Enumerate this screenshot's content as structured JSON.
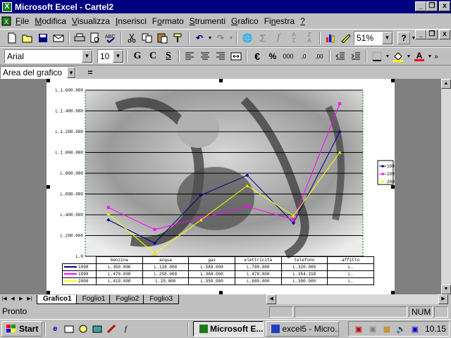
{
  "window": {
    "title": "Microsoft Excel - Cartel2",
    "app_icon": "X",
    "min": "_",
    "restore": "❐",
    "close": "x"
  },
  "menu": [
    {
      "key": "F",
      "rest": "ile"
    },
    {
      "key": "M",
      "rest": "odifica"
    },
    {
      "key": "V",
      "rest": "isualizza"
    },
    {
      "key": "I",
      "rest": "nserisci"
    },
    {
      "key": "",
      "rest": "Formato",
      "pre": "F",
      "post": "ormato"
    },
    {
      "key": "S",
      "rest": "trumenti"
    },
    {
      "key": "G",
      "rest": "rafico"
    },
    {
      "key": "n",
      "pre": "Fi",
      "post": "estra"
    },
    {
      "key": "?",
      "rest": ""
    }
  ],
  "toolbar": {
    "zoom": "51%"
  },
  "format_toolbar": {
    "font": "Arial",
    "size": "10",
    "bold": "G",
    "italic": "C",
    "underline": "S",
    "currency": "€",
    "percent": "%",
    "thousands": "000",
    "font_color": "A"
  },
  "formula_bar": {
    "namebox": "Area del grafico",
    "equals": "="
  },
  "chart_data": {
    "type": "line",
    "categories": [
      "benzina",
      "acqua",
      "gas",
      "elettricità",
      "telefono",
      "affitto"
    ],
    "y_ticks": [
      "L.1.600.000",
      "L.1.400.000",
      "L.1.200.000",
      "L.1.000.000",
      "L.800.000",
      "L.600.000",
      "L.400.000",
      "L.200.000",
      "L.0"
    ],
    "ylim": [
      0,
      1600000
    ],
    "series": [
      {
        "name": "1998",
        "color": "#000080",
        "values": [
          350000,
          128000,
          589000,
          780000,
          320000,
          1200000
        ],
        "labels": [
          "L.350.000",
          "L.128.000",
          "L.589.000",
          "L.780.000",
          "L.320.000",
          "L."
        ]
      },
      {
        "name": "1999",
        "color": "#ff00ff",
        "values": [
          470000,
          258000,
          368000,
          478000,
          354318,
          1470000
        ],
        "labels": [
          "L.470.000",
          "L.258.000",
          "L.368.000",
          "L.478.000",
          "L.354.318",
          "L."
        ]
      },
      {
        "name": "2000",
        "color": "#ffff00",
        "values": [
          410000,
          25000,
          350000,
          680000,
          390000,
          1000000
        ],
        "labels": [
          "L.410.000",
          "L.25.000",
          "L.350.000",
          "L.680.000",
          "L.390.000",
          "L."
        ]
      }
    ]
  },
  "sheet_tabs": [
    "Grafico1",
    "Foglio1",
    "Foglio2",
    "Foglio3"
  ],
  "status": {
    "text": "Pronto",
    "num": "NUM"
  },
  "taskbar": {
    "start": "Start",
    "tasks": [
      "Microsoft E...",
      "excel5 - Micro..."
    ],
    "clock": "10.15"
  }
}
